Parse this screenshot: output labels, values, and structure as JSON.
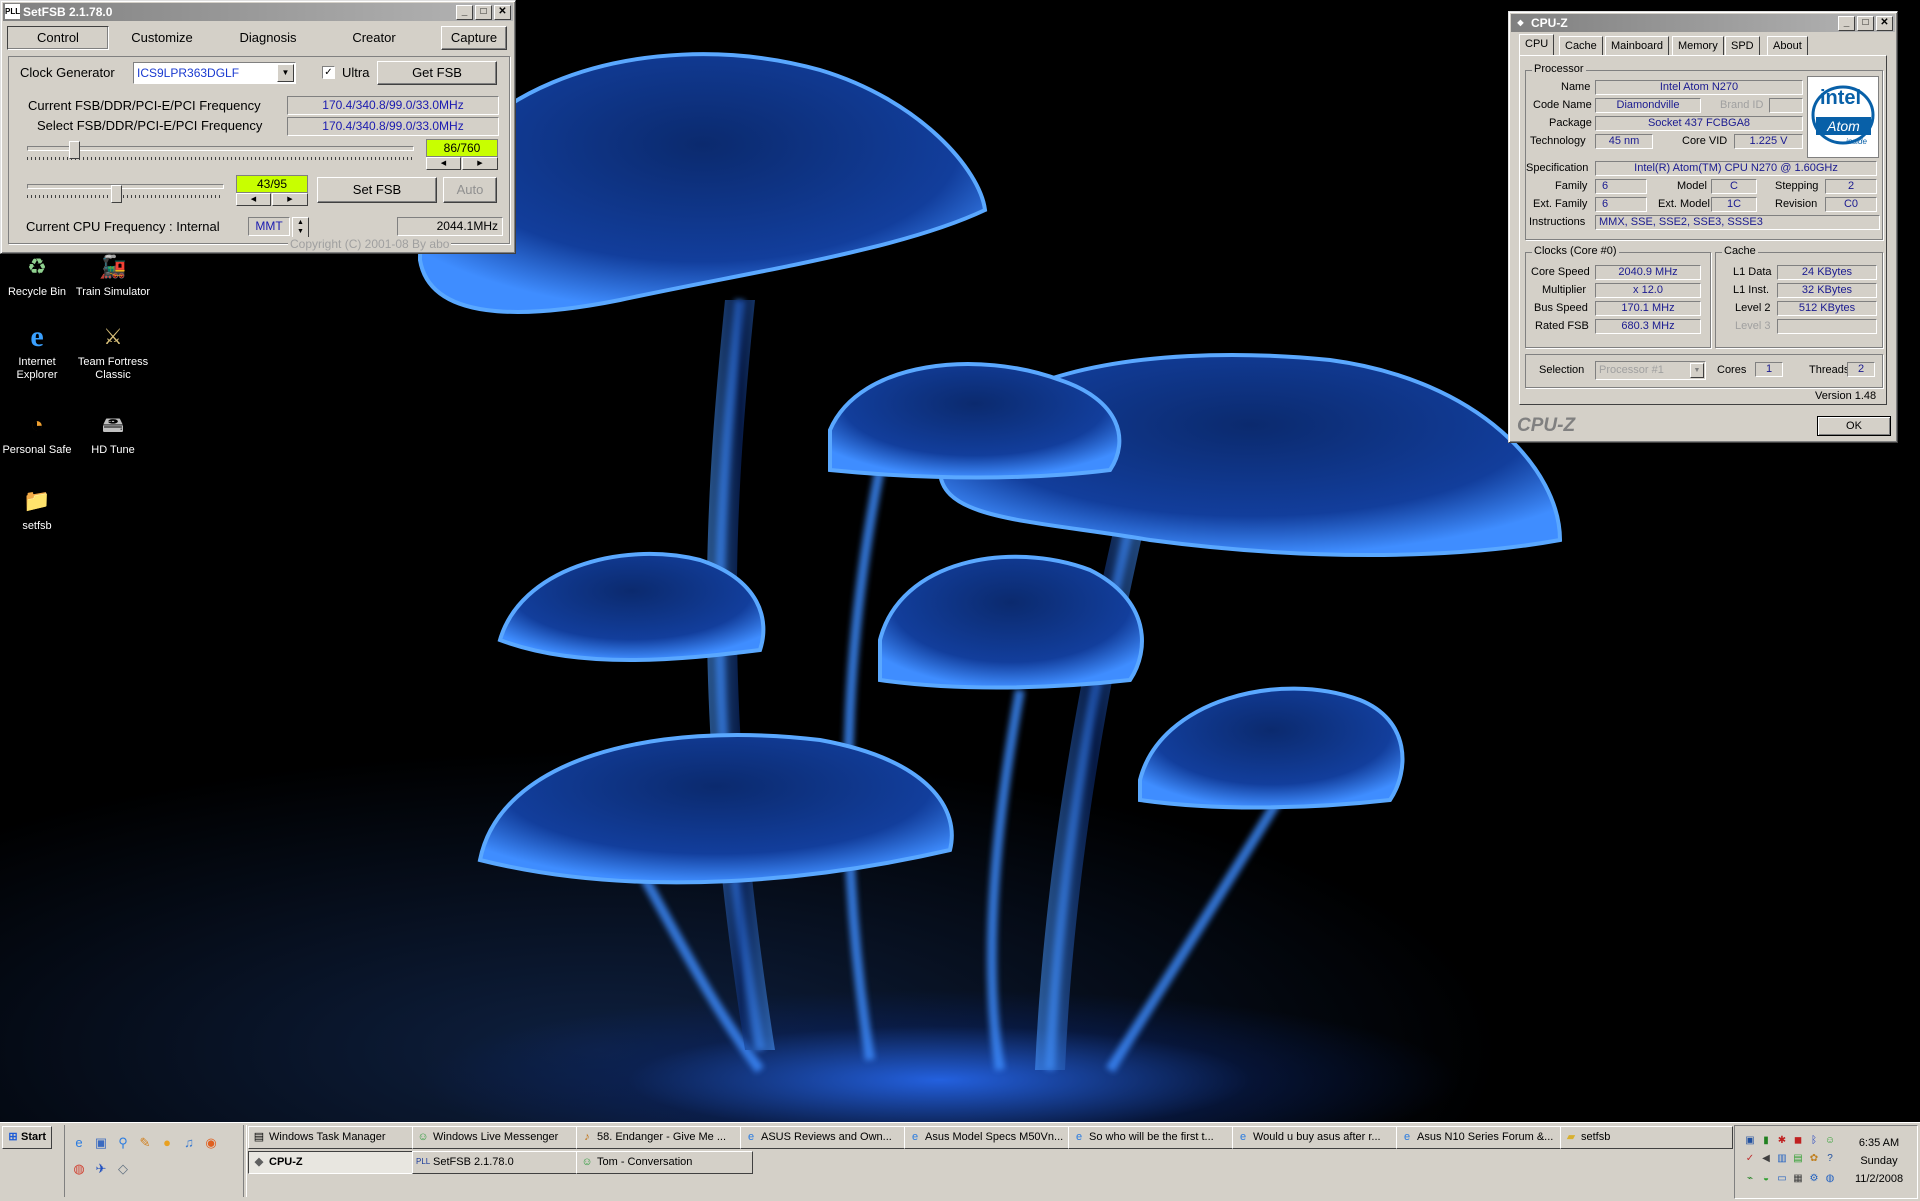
{
  "desktop": {
    "icons": [
      {
        "label": "Recycle Bin",
        "icon": "recycle-bin-icon"
      },
      {
        "label": "Train Simulator",
        "icon": "train-icon"
      },
      {
        "label": "Internet Explorer",
        "icon": "internet-explorer-icon"
      },
      {
        "label": "Team Fortress Classic",
        "icon": "team-fortress-icon"
      },
      {
        "label": "Personal Safe",
        "icon": "safe-icon"
      },
      {
        "label": "HD Tune",
        "icon": "hd-tune-icon"
      },
      {
        "label": "setfsb",
        "icon": "folder-icon"
      }
    ]
  },
  "setfsb": {
    "title": "SetFSB 2.1.78.0",
    "title_icon": "PLL",
    "tabs": [
      "Control",
      "Customize",
      "Diagnosis",
      "Creator"
    ],
    "capture_label": "Capture",
    "clock_generator_label": "Clock Generator",
    "clock_generator_value": "ICS9LPR363DGLF",
    "ultra_label": "Ultra",
    "ultra_checked": true,
    "get_fsb_label": "Get FSB",
    "current_freq_label": "Current FSB/DDR/PCI-E/PCI Frequency",
    "current_freq_value": "170.4/340.8/99.0/33.0MHz",
    "select_freq_label": "Select FSB/DDR/PCI-E/PCI Frequency",
    "select_freq_value": "170.4/340.8/99.0/33.0MHz",
    "slider1_readout": "86/760",
    "slider1_fraction": 0.113,
    "slider2_readout": "43/95",
    "slider2_fraction": 0.453,
    "set_fsb_label": "Set FSB",
    "auto_label": "Auto",
    "cpu_freq_label": "Current CPU Frequency : Internal",
    "cpu_freq_source": "MMT",
    "cpu_freq_value": "2044.1MHz",
    "copyright": "Copyright (C) 2001-08 By abo"
  },
  "cpuz": {
    "title": "CPU-Z",
    "tabs": [
      "CPU",
      "Cache",
      "Mainboard",
      "Memory",
      "SPD",
      "About"
    ],
    "processor_group": "Processor",
    "name_label": "Name",
    "name_value": "Intel Atom N270",
    "codename_label": "Code Name",
    "codename_value": "Diamondville",
    "brandid_label": "Brand ID",
    "brandid_value": "",
    "package_label": "Package",
    "package_value": "Socket 437 FCBGA8",
    "technology_label": "Technology",
    "technology_value": "45 nm",
    "corevid_label": "Core VID",
    "corevid_value": "1.225 V",
    "spec_label": "Specification",
    "spec_value": "Intel(R) Atom(TM) CPU N270   @ 1.60GHz",
    "family_label": "Family",
    "family_value": "6",
    "model_label": "Model",
    "model_value": "C",
    "stepping_label": "Stepping",
    "stepping_value": "2",
    "extfamily_label": "Ext. Family",
    "extfamily_value": "6",
    "extmodel_label": "Ext. Model",
    "extmodel_value": "1C",
    "revision_label": "Revision",
    "revision_value": "C0",
    "instructions_label": "Instructions",
    "instructions_value": "MMX, SSE, SSE2, SSE3, SSSE3",
    "logo_brand": "intel",
    "logo_product": "Atom",
    "logo_inside": "inside",
    "clocks_group": "Clocks (Core #0)",
    "corespeed_label": "Core Speed",
    "corespeed_value": "2040.9 MHz",
    "multiplier_label": "Multiplier",
    "multiplier_value": "x 12.0",
    "busspeed_label": "Bus Speed",
    "busspeed_value": "170.1 MHz",
    "ratedfsb_label": "Rated FSB",
    "ratedfsb_value": "680.3 MHz",
    "cache_group": "Cache",
    "l1data_label": "L1 Data",
    "l1data_value": "24 KBytes",
    "l1inst_label": "L1 Inst.",
    "l1inst_value": "32 KBytes",
    "level2_label": "Level 2",
    "level2_value": "512 KBytes",
    "level3_label": "Level 3",
    "level3_value": "",
    "selection_label": "Selection",
    "selection_value": "Processor #1",
    "cores_label": "Cores",
    "cores_value": "1",
    "threads_label": "Threads",
    "threads_value": "2",
    "version": "Version 1.48",
    "brand_footer": "CPU-Z",
    "ok_label": "OK"
  },
  "taskbar": {
    "start_label": "Start",
    "row1": [
      {
        "label": "Windows Task Manager",
        "icon": "task-manager-icon"
      },
      {
        "label": "Windows Live Messenger",
        "icon": "messenger-icon"
      },
      {
        "label": "58. Endanger - Give Me ...",
        "icon": "music-icon"
      },
      {
        "label": "ASUS Reviews and Own...",
        "icon": "ie-icon"
      },
      {
        "label": "Asus Model Specs M50Vn...",
        "icon": "ie-icon"
      },
      {
        "label": "So who will be the first t...",
        "icon": "ie-icon"
      },
      {
        "label": "Would u buy asus after r...",
        "icon": "ie-icon"
      },
      {
        "label": "Asus N10 Series Forum &...",
        "icon": "ie-icon"
      },
      {
        "label": "setfsb",
        "icon": "folder-icon"
      }
    ],
    "row2": [
      {
        "label": "CPU-Z",
        "icon": "cpuz-icon",
        "active": true
      },
      {
        "label": "SetFSB 2.1.78.0",
        "icon": "setfsb-icon"
      },
      {
        "label": "Tom - Conversation",
        "icon": "messenger-icon"
      }
    ],
    "clock_time": "6:35 AM",
    "clock_day": "Sunday",
    "clock_date": "11/2/2008"
  },
  "colors": {
    "window_face": "#d4d0c8",
    "inactive_title": "#808080",
    "value_text": "#1a1ab0",
    "readout_bg": "#c8ff00",
    "wallpaper_glow": "#3a8cff"
  }
}
